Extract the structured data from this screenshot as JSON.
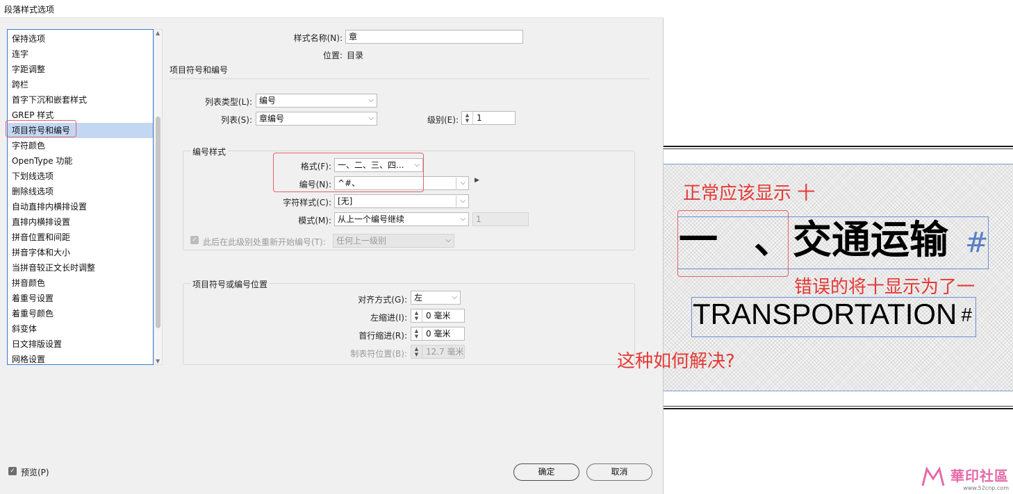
{
  "dialog": {
    "title": "段落样式选项",
    "style_name_label": "样式名称(N):",
    "style_name_value": "章",
    "position_label": "位置:",
    "position_value": "目录",
    "section_title": "项目符号和编号",
    "sidebar_items": [
      "保持选项",
      "连字",
      "字距调整",
      "跨栏",
      "首字下沉和嵌套样式",
      "GREP 样式",
      "项目符号和编号",
      "字符颜色",
      "OpenType 功能",
      "下划线选项",
      "删除线选项",
      "自动直排内横排设置",
      "直排内横排设置",
      "拼音位置和间距",
      "拼音字体和大小",
      "当拼音较正文长时调整",
      "拼音颜色",
      "着重号设置",
      "着重号颜色",
      "斜变体",
      "日文排版设置",
      "网格设置"
    ],
    "selected_index": 6,
    "list_type_label": "列表类型(L):",
    "list_type_value": "编号",
    "list_label": "列表(S):",
    "list_value": "章编号",
    "level_label": "级别(E):",
    "level_value": "1",
    "numbering_style": {
      "title": "编号样式",
      "format_label": "格式(F):",
      "format_value": "一、二、三、四...",
      "number_label": "编号(N):",
      "number_value": "^#、",
      "char_style_label": "字符样式(C):",
      "char_style_value": "[无]",
      "mode_label": "模式(M):",
      "mode_value": "从上一个编号继续",
      "mode_number": "1",
      "restart_label": "此后在此级别处重新开始编号(T):",
      "restart_value": "任何上一级别"
    },
    "position_group": {
      "title": "项目符号或编号位置",
      "align_label": "对齐方式(G):",
      "align_value": "左",
      "left_indent_label": "左缩进(I):",
      "left_indent_value": "0 毫米",
      "first_indent_label": "首行缩进(R):",
      "first_indent_value": "0 毫米",
      "tab_pos_label": "制表符位置(B):",
      "tab_pos_value": "12.7 毫米"
    },
    "preview_label": "预览(P)",
    "ok_label": "确定",
    "cancel_label": "取消"
  },
  "preview": {
    "note_top": "正常应该显示    十",
    "heading_number": "一",
    "heading_sep": "、",
    "heading_text": "交通运输",
    "hash": "#",
    "note_mid": "错误的将十显示为了一",
    "english_heading": "TRANSPORTATION",
    "note_bottom": "这种如何解决?",
    "watermark_text": "華印社區",
    "watermark_url": "www.52cnp.com"
  },
  "colors": {
    "annotation_red": "#e53935",
    "selection_blue": "#c3d7f3",
    "frame_blue": "#6a8ed0",
    "watermark_pink": "#e46aa7"
  },
  "icons": {
    "dropdown": "chevron-down-icon",
    "stepper": "spin-updown-icon",
    "checkbox": "check-icon",
    "flyout": "triangle-right-icon"
  }
}
